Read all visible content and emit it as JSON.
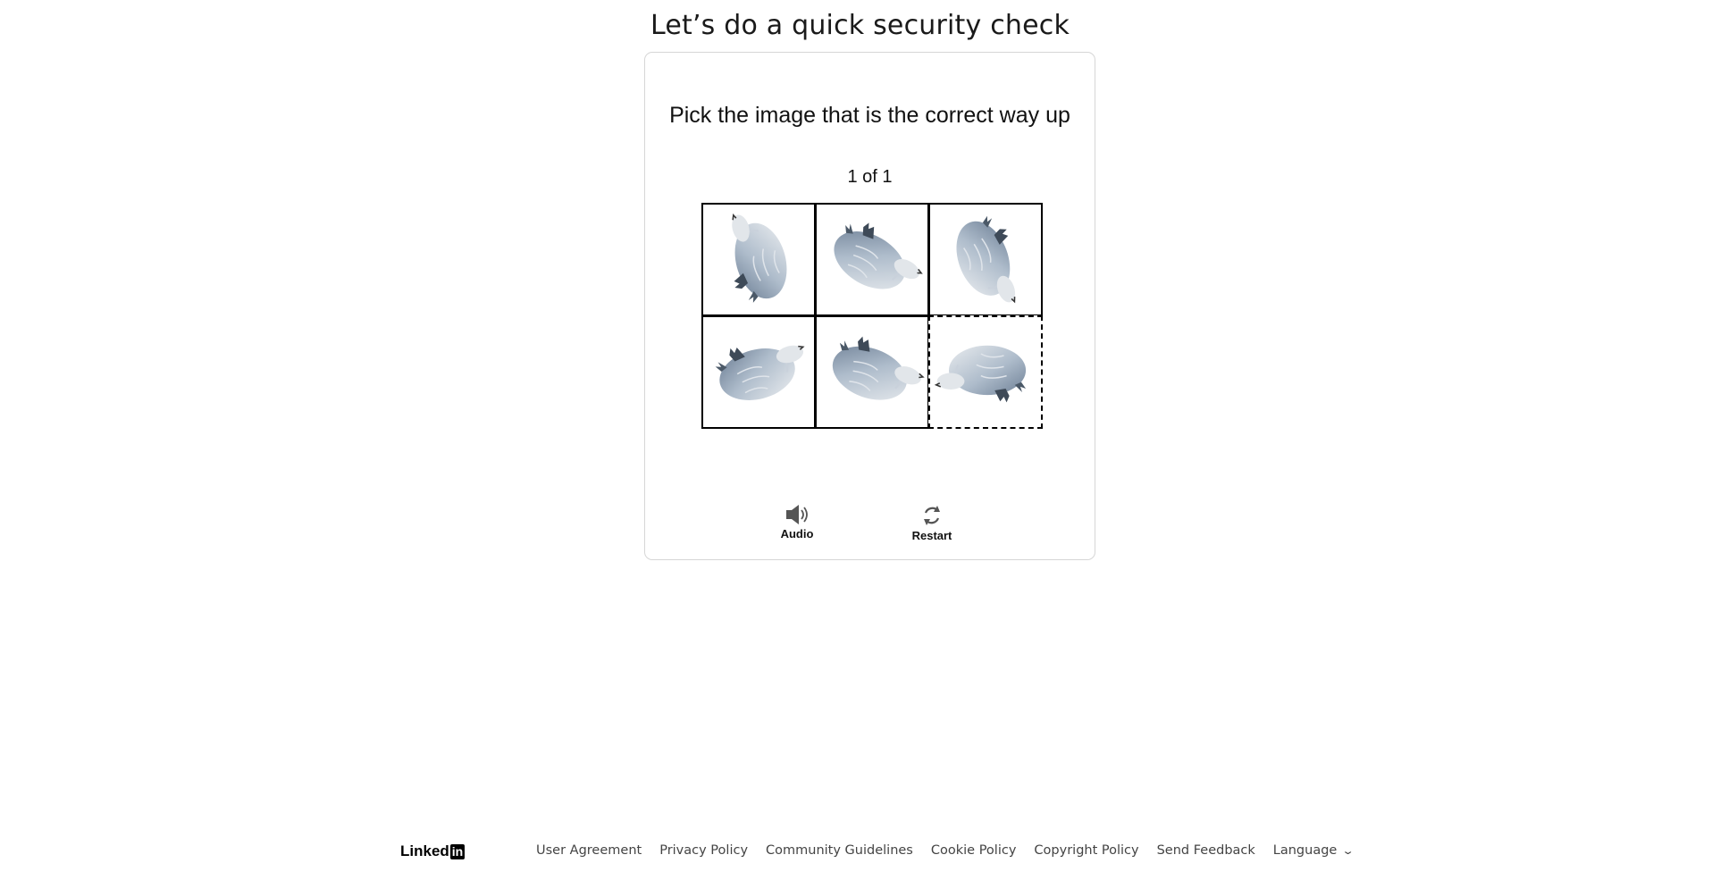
{
  "header": {
    "title": "Let’s do a quick security check"
  },
  "challenge": {
    "prompt": "Pick the image that is the correct way up",
    "counter": "1 of 1",
    "tiles": [
      {
        "rotation": 75,
        "selected": false
      },
      {
        "rotation": -150,
        "selected": false
      },
      {
        "rotation": -110,
        "selected": false
      },
      {
        "rotation": 165,
        "selected": false
      },
      {
        "rotation": 200,
        "selected": false
      },
      {
        "rotation": 0,
        "selected": true
      }
    ],
    "audio_label": "Audio",
    "restart_label": "Restart"
  },
  "footer": {
    "logo_text": "Linked",
    "logo_badge": "in",
    "links": [
      "User Agreement",
      "Privacy Policy",
      "Community Guidelines",
      "Cookie Policy",
      "Copyright Policy",
      "Send Feedback"
    ],
    "language_label": "Language"
  },
  "colors": {
    "accent": "#000000",
    "card_border": "#d6d6d6",
    "link_text": "#444444"
  }
}
